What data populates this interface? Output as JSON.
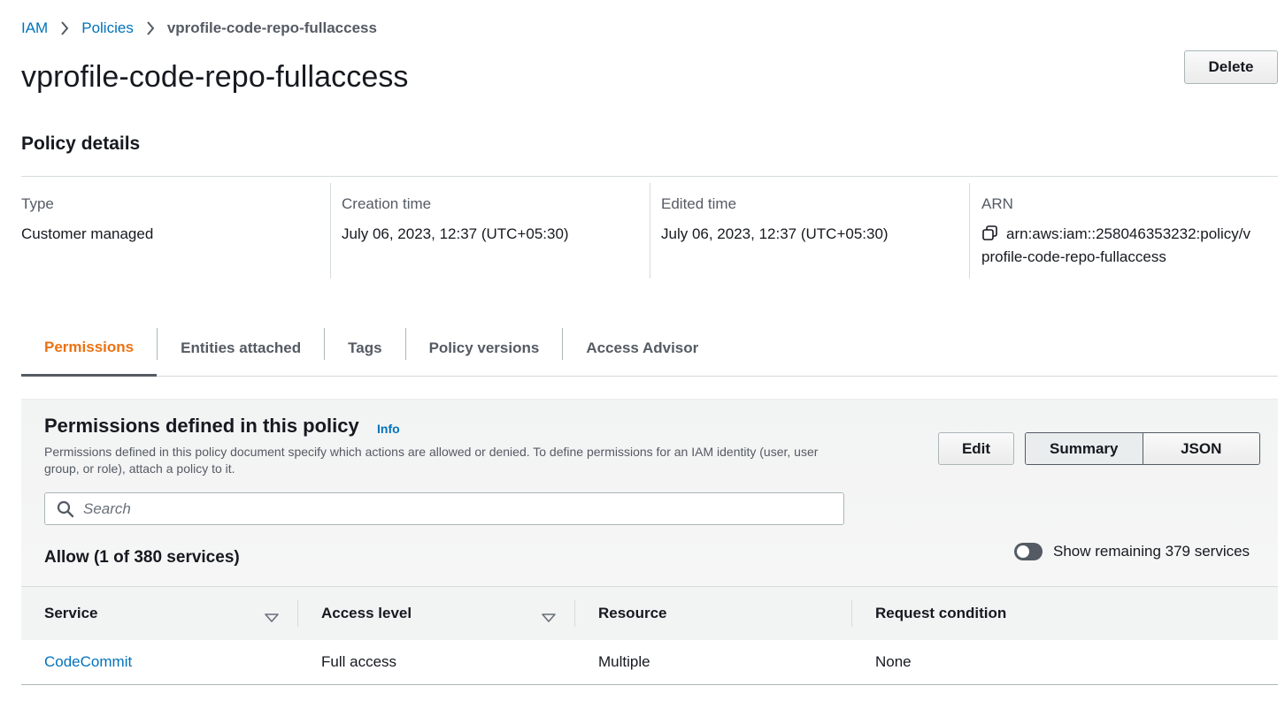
{
  "breadcrumb": {
    "items": [
      {
        "label": "IAM"
      },
      {
        "label": "Policies"
      }
    ],
    "current": "vprofile-code-repo-fullaccess"
  },
  "page": {
    "title": "vprofile-code-repo-fullaccess",
    "delete_label": "Delete"
  },
  "policy_details": {
    "section_title": "Policy details",
    "fields": [
      {
        "label": "Type",
        "value": "Customer managed"
      },
      {
        "label": "Creation time",
        "value": "July 06, 2023, 12:37 (UTC+05:30)"
      },
      {
        "label": "Edited time",
        "value": "July 06, 2023, 12:37 (UTC+05:30)"
      },
      {
        "label": "ARN",
        "value": "arn:aws:iam::258046353232:policy/vprofile-code-repo-fullaccess"
      }
    ]
  },
  "tabs": [
    {
      "label": "Permissions",
      "active": true
    },
    {
      "label": "Entities attached",
      "active": false
    },
    {
      "label": "Tags",
      "active": false
    },
    {
      "label": "Policy versions",
      "active": false
    },
    {
      "label": "Access Advisor",
      "active": false
    }
  ],
  "permissions": {
    "title": "Permissions defined in this policy",
    "info_label": "Info",
    "description": "Permissions defined in this policy document specify which actions are allowed or denied. To define permissions for an IAM identity (user, user group, or role), attach a policy to it.",
    "edit_label": "Edit",
    "view_modes": [
      "Summary",
      "JSON"
    ],
    "selected_view": "Summary",
    "search_placeholder": "Search",
    "allow_title": "Allow (1 of 380 services)",
    "toggle_label": "Show remaining 379 services",
    "toggle_on": false,
    "columns": [
      "Service",
      "Access level",
      "Resource",
      "Request condition"
    ],
    "rows": [
      {
        "service": "CodeCommit",
        "access_level": "Full access",
        "resource": "Multiple",
        "request_condition": "None"
      }
    ]
  },
  "colors": {
    "link": "#0073bb",
    "active_tab": "#ec7211",
    "text": "#16191f",
    "muted": "#545b64",
    "panel_bg": "#f2f3f3"
  }
}
